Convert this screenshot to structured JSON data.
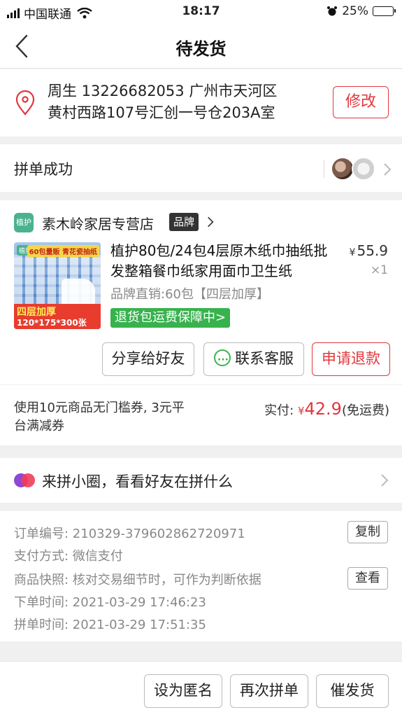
{
  "status_bar": {
    "carrier": "中国联通",
    "time": "18:17",
    "battery": "25%",
    "battery_level": 0.25
  },
  "nav": {
    "title": "待发货"
  },
  "address": {
    "line1": "周生 13226682053 广州市天河区",
    "line2": "黄村西路107号汇创一号仓203A室",
    "modify": "修改"
  },
  "group": {
    "title": "拼单成功"
  },
  "store": {
    "logo": "植护",
    "name": "素木岭家居专营店",
    "badge": "品牌"
  },
  "product": {
    "image_logo": "植护",
    "image_tag_top": "60包量贩 青花瓷抽纸",
    "image_tag_bottom1": "四层加厚",
    "image_tag_bottom2": "120*175*300张",
    "title": "植护80包/24包4层原木纸巾抽纸批发整箱餐巾纸家用面巾卫生纸",
    "currency": "¥",
    "price": "55.9",
    "qty": "×1",
    "spec": "品牌直销:60包【四层加厚】",
    "guarantee": "退货包运费保障中>"
  },
  "actions": {
    "share": "分享给好友",
    "contact": "联系客服",
    "refund": "申请退款"
  },
  "payment": {
    "coupon": "使用10元商品无门槛券, 3元平台满减券",
    "paid_label": "实付:",
    "paid_currency": "¥",
    "paid_amount": "42.9",
    "paid_note": "(免运费)"
  },
  "circle": {
    "text": "来拼小圈，看看好友在拼什么"
  },
  "order_info": {
    "order_no": "订单编号:  210329-379602862720971",
    "pay_method": "支付方式:  微信支付",
    "snapshot": "商品快照:  核对交易细节时，可作为判断依据",
    "order_time": "下单时间:  2021-03-29 17:46:23",
    "group_time": "拼单时间:  2021-03-29 17:51:35",
    "copy": "复制",
    "view": "查看"
  },
  "bottom": {
    "anon": "设为匿名",
    "rebuy": "再次拼单",
    "urge": "催发货"
  },
  "colors": {
    "accent_red": "#e0383e",
    "guarantee_green": "#37b24d"
  }
}
